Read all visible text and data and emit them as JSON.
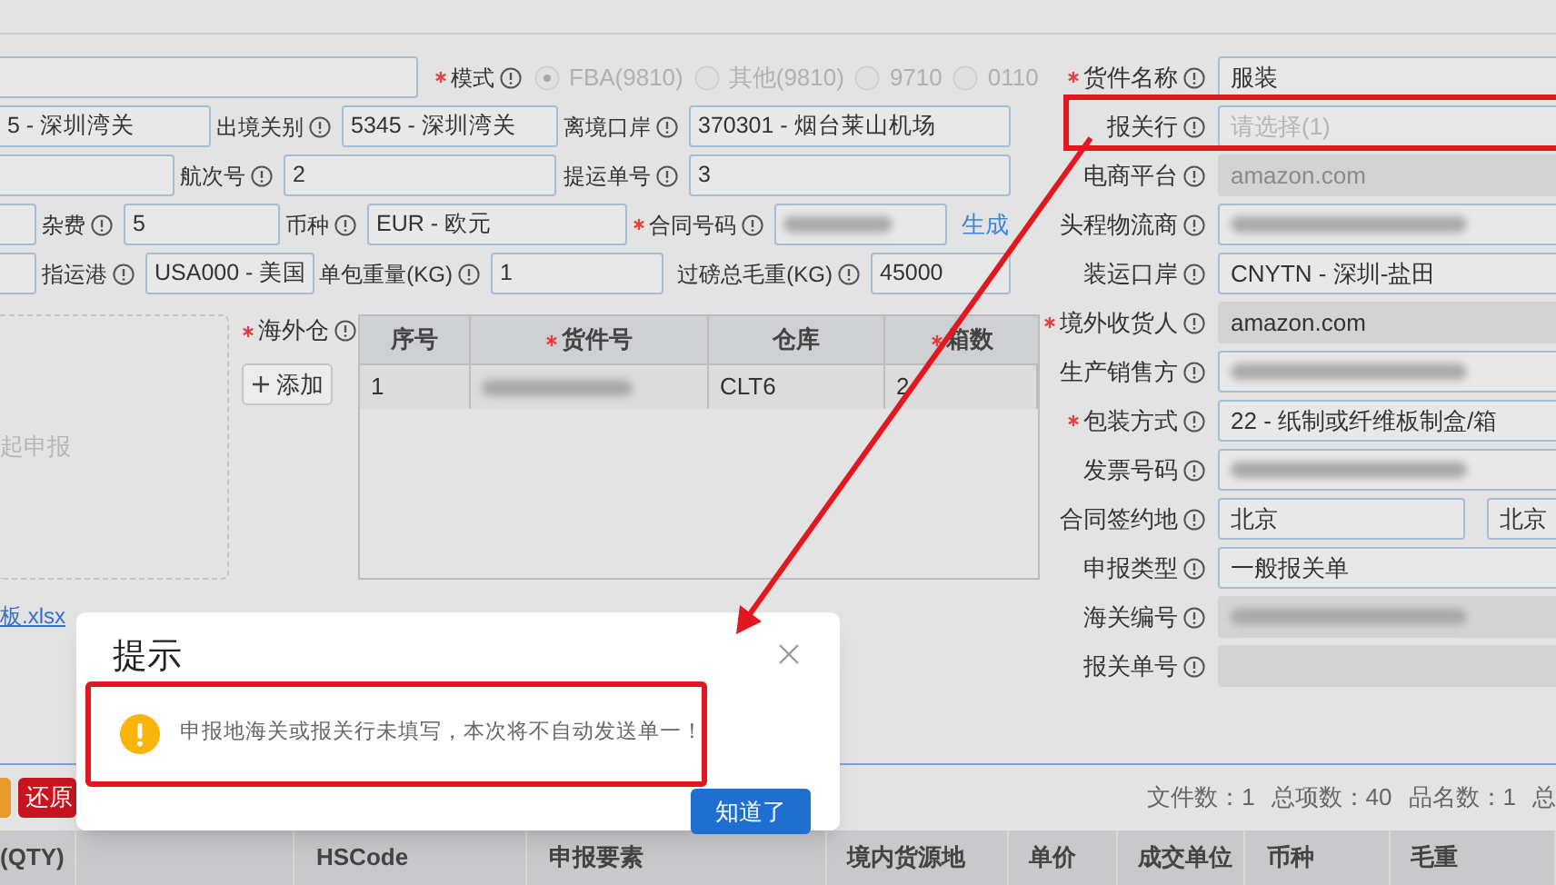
{
  "form_rows": [
    [
      {
        "kind": "field"
      },
      {
        "kind": "label",
        "text": "模式",
        "required": true
      },
      {
        "kind": "radio",
        "label": "FBA(9810)",
        "selected": true
      },
      {
        "kind": "radio",
        "label": "其他(9810)",
        "selected": false
      },
      {
        "kind": "radio",
        "label": "9710",
        "selected": false
      },
      {
        "kind": "radio",
        "label": "0110",
        "selected": false
      }
    ],
    [
      {
        "kind": "field",
        "value": "5 - 深圳湾关"
      },
      {
        "kind": "label",
        "text": "出境关别",
        "required": false
      },
      {
        "kind": "field",
        "value": "5345 - 深圳湾关"
      },
      {
        "kind": "label",
        "text": "离境口岸",
        "required": false
      },
      {
        "kind": "field",
        "value": "370301 - 烟台莱山机场"
      }
    ],
    [
      {
        "kind": "field"
      },
      {
        "kind": "label",
        "text": "航次号",
        "required": false
      },
      {
        "kind": "field",
        "value": "2"
      },
      {
        "kind": "label",
        "text": "提运单号",
        "required": false
      },
      {
        "kind": "field",
        "value": "3"
      }
    ],
    [
      {
        "kind": "field"
      },
      {
        "kind": "label",
        "text": "杂费",
        "required": false
      },
      {
        "kind": "field",
        "value": "5"
      },
      {
        "kind": "label",
        "text": "币种",
        "required": false
      },
      {
        "kind": "field",
        "value": "EUR - 欧元"
      },
      {
        "kind": "label",
        "text": "合同号码",
        "required": true
      },
      {
        "kind": "field",
        "redacted": true
      },
      {
        "kind": "link",
        "text": "生成"
      }
    ],
    [
      {
        "kind": "field"
      },
      {
        "kind": "label",
        "text": "指运港",
        "required": false
      },
      {
        "kind": "field",
        "value": "USA000 - 美国"
      },
      {
        "kind": "label",
        "text": "单包重量(KG)",
        "required": false
      },
      {
        "kind": "field",
        "value": "1"
      },
      {
        "kind": "label",
        "text": "过磅总毛重(KG)",
        "required": false
      },
      {
        "kind": "field",
        "value": "45000"
      }
    ]
  ],
  "upload_area": {
    "hint": "起申报"
  },
  "warehouse": {
    "label": "海外仓",
    "required": true,
    "add_button": "添加",
    "columns": [
      {
        "title": "序号",
        "required": false
      },
      {
        "title": "货件号",
        "required": true
      },
      {
        "title": "仓库",
        "required": false
      },
      {
        "title": "箱数",
        "required": true
      }
    ],
    "rows": [
      {
        "cells": [
          {
            "text": "1"
          },
          {
            "redacted": true
          },
          {
            "text": "CLT6"
          },
          {
            "text": "2"
          }
        ]
      }
    ]
  },
  "template_link": "板.xlsx",
  "right_fields": [
    {
      "label": "货件名称",
      "required": true,
      "kind": "input",
      "value": "服装",
      "highlighted": false
    },
    {
      "label": "报关行",
      "required": false,
      "kind": "input",
      "placeholder": "请选择(1)",
      "highlighted": true
    },
    {
      "label": "电商平台",
      "required": false,
      "kind": "disabled",
      "value": "amazon.com",
      "highlighted": false
    },
    {
      "label": "头程物流商",
      "required": false,
      "kind": "input",
      "redacted": true,
      "highlighted": false
    },
    {
      "label": "装运口岸",
      "required": false,
      "kind": "input",
      "value": "CNYTN - 深圳-盐田",
      "highlighted": false
    },
    {
      "label": "境外收货人",
      "required": true,
      "kind": "readonly",
      "value": "amazon.com",
      "highlighted": false
    },
    {
      "label": "生产销售方",
      "required": false,
      "kind": "input",
      "redacted": true,
      "highlighted": false
    },
    {
      "label": "包装方式",
      "required": true,
      "kind": "input",
      "value": "22 - 纸制或纤维板制盒/箱",
      "highlighted": false
    },
    {
      "label": "发票号码",
      "required": false,
      "kind": "input",
      "redacted": true,
      "highlighted": false
    },
    {
      "label": "合同签约地",
      "required": false,
      "kind": "input",
      "value": "北京",
      "extra_value": "北京",
      "highlighted": false
    },
    {
      "label": "申报类型",
      "required": false,
      "kind": "input",
      "value": "一般报关单",
      "highlighted": false
    },
    {
      "label": "海关编号",
      "required": false,
      "kind": "readonly",
      "redacted": true,
      "highlighted": false
    },
    {
      "label": "报关单号",
      "required": false,
      "kind": "readonly",
      "highlighted": false
    }
  ],
  "actions": [
    {
      "color": "#e89a2c"
    },
    {
      "color": "#c8141f",
      "label": "还原"
    }
  ],
  "stats": [
    "文件数：1",
    "总项数：40",
    "品名数：1",
    "总"
  ],
  "items_table": {
    "columns": [
      "(QTY)",
      "",
      "HSCode",
      "申报要素",
      "境内货源地",
      "单价",
      "成交单位",
      "币种",
      "毛重"
    ]
  },
  "dialog": {
    "title": "提示",
    "message": "申报地海关或报关行未填写，本次将不自动发送单一！",
    "confirm": "知道了",
    "highlighted": true
  }
}
